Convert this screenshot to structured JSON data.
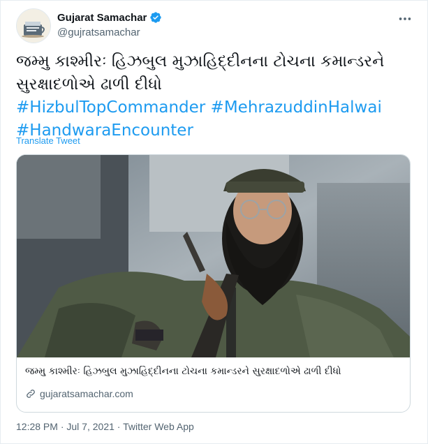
{
  "author": {
    "display_name": "Gujarat Samachar",
    "handle": "@gujratsamachar",
    "verified": true,
    "avatar_icon": "newspaper-logo-icon"
  },
  "tweet": {
    "text_line1": "જમ્મુ કાશ્મીરઃ હિઝબુલ મુઝાહિદ્દીનના ટોચના કમાન્ડરને",
    "text_line2": "સુરક્ષાદળોએ ઢાળી દીધો",
    "hashtags": [
      "#HizbulTopCommander",
      "#MehrazuddinHalwai",
      "#HandwaraEncounter"
    ],
    "translate_label": "Translate Tweet"
  },
  "card": {
    "title": "જમ્મુ કાશ્મીરઃ હિઝબુલ મુઝાહિદ્દીનના ટોચના કમાન્ડરને સુરક્ષાદળોએ ઢાળી દીધો",
    "domain": "gujaratsamachar.com",
    "link_icon": "link-icon"
  },
  "meta": {
    "time": "12:28 PM",
    "date": "Jul 7, 2021",
    "source": "Twitter Web App",
    "separator": " · "
  },
  "colors": {
    "link_blue": "#1d9bf0",
    "secondary_text": "#536471",
    "border": "#cfd9de"
  }
}
